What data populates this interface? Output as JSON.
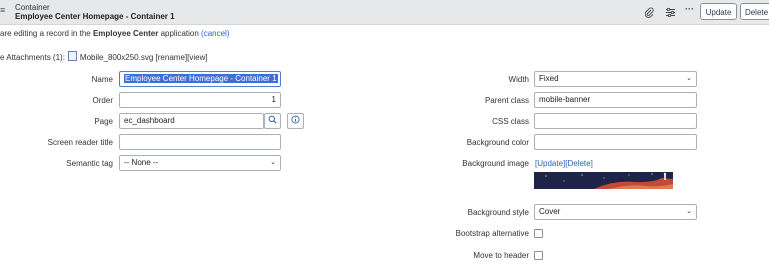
{
  "header": {
    "menu_icon": "≡",
    "record_type": "Container",
    "record_title": "Employee Center Homepage - Container 1",
    "icons": [
      "paperclip-icon",
      "sliders-icon",
      "more-icon"
    ],
    "update_label": "Update",
    "delete_label": "Delete"
  },
  "info": {
    "prefix": "are editing a record in the",
    "app_name": "Employee Center",
    "suffix": "application",
    "cancel_label": "(cancel)"
  },
  "attachments": {
    "label": "e Attachments (1):",
    "file_name": "Mobile_800x250.svg",
    "rename_label": "[rename]",
    "view_label": "[view]"
  },
  "left_fields": {
    "name_label": "Name",
    "name_value": "Employee Center Homepage - Container 1",
    "order_label": "Order",
    "order_value": "1",
    "page_label": "Page",
    "page_value": "ec_dashboard",
    "screen_reader_label": "Screen reader title",
    "screen_reader_value": "",
    "semantic_tag_label": "Semantic tag",
    "semantic_tag_value": "-- None --"
  },
  "right_fields": {
    "width_label": "Width",
    "width_value": "Fixed",
    "parent_class_label": "Parent class",
    "parent_class_value": "mobile-banner",
    "css_class_label": "CSS class",
    "css_class_value": "",
    "bg_color_label": "Background color",
    "bg_color_value": "",
    "bg_image_label": "Background image",
    "bg_image_update": "[Update]",
    "bg_image_delete": "[Delete]",
    "bg_style_label": "Background style",
    "bg_style_value": "Cover",
    "bootstrap_label": "Bootstrap alternative",
    "bootstrap_checked": false,
    "move_header_label": "Move to header",
    "move_header_checked": false
  },
  "colors": {
    "link": "#2e63b8",
    "header_bg": "#e6e8ea",
    "selection": "#3d6fd6"
  }
}
